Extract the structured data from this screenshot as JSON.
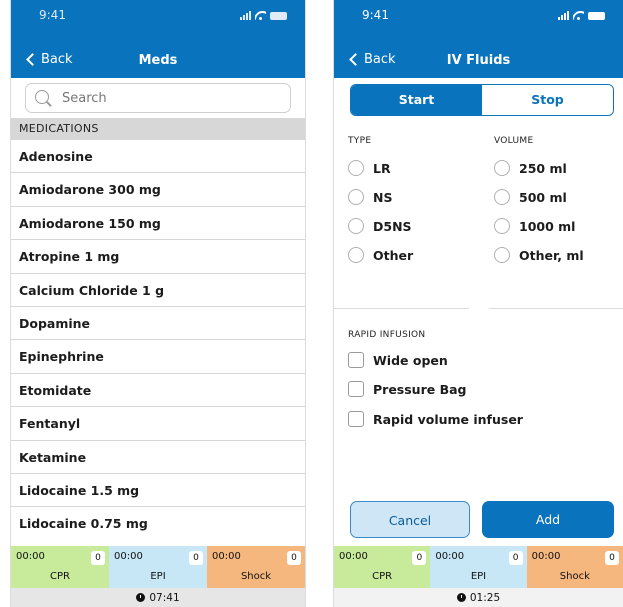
{
  "left": {
    "status_time": "9:41",
    "back_label": "Back",
    "title": "Meds",
    "search_placeholder": "Search",
    "section_title": "MEDICATIONS",
    "medications": [
      "Adenosine",
      "Amiodarone 300 mg",
      "Amiodarone 150 mg",
      "Atropine 1 mg",
      "Calcium Chloride 1 g",
      "Dopamine",
      "Epinephrine",
      "Etomidate",
      "Fentanyl",
      "Ketamine",
      "Lidocaine 1.5 mg",
      "Lidocaine 0.75 mg"
    ],
    "timers": [
      {
        "label": "CPR",
        "time": "00:00",
        "count": "0"
      },
      {
        "label": "EPI",
        "time": "00:00",
        "count": "0"
      },
      {
        "label": "Shock",
        "time": "00:00",
        "count": "0"
      }
    ],
    "elapsed": "07:41"
  },
  "right": {
    "status_time": "9:41",
    "back_label": "Back",
    "title": "IV Fluids",
    "segments": {
      "start": "Start",
      "stop": "Stop",
      "selected": "Start"
    },
    "type_header": "TYPE",
    "volume_header": "VOLUME",
    "types": [
      "LR",
      "NS",
      "D5NS",
      "Other"
    ],
    "volumes": [
      "250 ml",
      "500 ml",
      "1000 ml",
      "Other, ml"
    ],
    "rapid_header": "RAPID INFUSION",
    "rapid_options": [
      "Wide open",
      "Pressure Bag",
      "Rapid volume infuser"
    ],
    "cancel_label": "Cancel",
    "add_label": "Add",
    "timers": [
      {
        "label": "CPR",
        "time": "00:00",
        "count": "0"
      },
      {
        "label": "EPI",
        "time": "00:00",
        "count": "0"
      },
      {
        "label": "Shock",
        "time": "00:00",
        "count": "0"
      }
    ],
    "elapsed": "01:25"
  },
  "colors": {
    "brand_blue": "#0a73bd",
    "cpr": "#c7eb9b",
    "epi": "#c8e7f6",
    "shock": "#f6b77f"
  }
}
